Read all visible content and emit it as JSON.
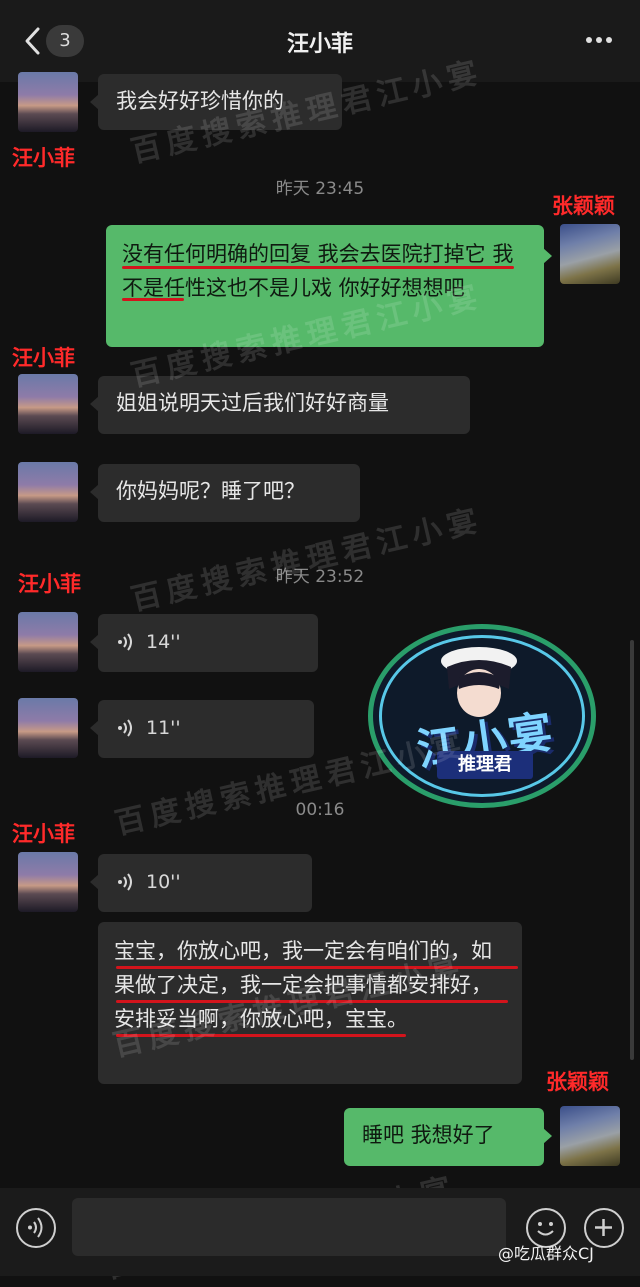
{
  "header": {
    "back_count": "3",
    "title": "汪小菲"
  },
  "names": {
    "left": "汪小菲",
    "right": "张颖颖"
  },
  "times": [
    "昨天 23:45",
    "昨天 23:52",
    "00:16"
  ],
  "messages": {
    "m1": "我会好好珍惜你的",
    "m2": "没有任何明确的回复 我会去医院打掉它 我不是任性这也不是儿戏 你好好想想吧",
    "m3": "姐姐说明天过后我们好好商量",
    "m4": "你妈妈呢？睡了吧？",
    "v1": "14''",
    "v2": "11''",
    "v3": "10''",
    "m5": "宝宝，你放心吧，我一定会有咱们的，如果做了决定，我一定会把事情都安排好，安排妥当啊，你放心吧，宝宝。",
    "m6": "睡吧 我想好了"
  },
  "watermark": {
    "text": "百度搜索推理君江小宴"
  },
  "logo": {
    "main": "江小宴",
    "sub": "推理君"
  },
  "credit": "@吃瓜群众CJ",
  "colors": {
    "bg": "#111111",
    "bubble_in": "#2c2c2c",
    "bubble_out": "#56b96a",
    "name_red": "#ff2a2a",
    "underline": "#d3141c"
  },
  "icons": [
    "back-chevron-icon",
    "more-dots-icon",
    "voice-wave-icon",
    "emoji-icon",
    "add-icon"
  ]
}
